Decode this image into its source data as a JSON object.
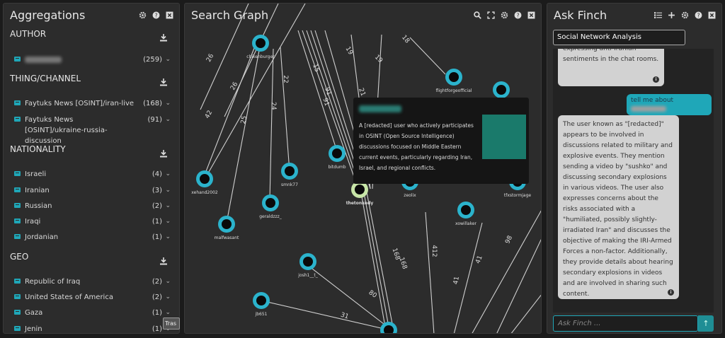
{
  "aggregations": {
    "title": "Aggregations",
    "sections": [
      {
        "name": "AUTHOR",
        "items": [
          {
            "label": "",
            "count": "(259)"
          }
        ]
      },
      {
        "name": "THING/CHANNEL",
        "items": [
          {
            "label": "Faytuks News [OSINT]/iran-live",
            "count": "(168)"
          },
          {
            "label": "Faytuks News [OSINT]/ukraine-russia-discussion",
            "count": "(91)"
          }
        ]
      },
      {
        "name": "NATIONALITY",
        "items": [
          {
            "label": "Israeli",
            "count": "(4)"
          },
          {
            "label": "Iranian",
            "count": "(3)"
          },
          {
            "label": "Russian",
            "count": "(2)"
          },
          {
            "label": "Iraqi",
            "count": "(1)"
          },
          {
            "label": "Jordanian",
            "count": "(1)"
          }
        ]
      },
      {
        "name": "GEO",
        "items": [
          {
            "label": "Republic of Iraq",
            "count": "(2)"
          },
          {
            "label": "United States of America",
            "count": "(2)"
          },
          {
            "label": "Gaza",
            "count": "(1)"
          },
          {
            "label": "Jenin",
            "count": "(1)"
          }
        ]
      }
    ]
  },
  "graph": {
    "title": "Search Graph",
    "node_labels": {
      "n1": "chikenburger",
      "n2": "flightforgeofficial",
      "n3": "xehand2002",
      "n4": "smnk77",
      "n5": "bitdumb",
      "n6": "geraldzzz_",
      "n7": "thetonkedy",
      "n8": "zeolix",
      "n9": "tfxstormjage",
      "n10": "xowillaker",
      "n11": "malfwasant",
      "n12": "josh1__t_",
      "n13": "jb651"
    },
    "edge_labels": [
      "26",
      "26",
      "18",
      "19",
      "19",
      "15",
      "91",
      "21",
      "22",
      "24",
      "42",
      "25",
      "91",
      "168",
      "168",
      "412",
      "41",
      "41",
      "98",
      "80",
      "31"
    ],
    "tooltip": {
      "text": "A [redacted] user who actively participates in OSINT (Open Source Intelligence) discussions focused on Middle Eastern current events, particularly regarding Iran, Israel, and regional conflicts."
    }
  },
  "finch": {
    "title": "Ask Finch",
    "query": "Social Network Analysis",
    "prev_message": "expressing anti-Iranian sentiments in the chat rooms.",
    "user_message": "tell me about",
    "response": "The user known as \"[redacted]\" appears to be involved in discussions related to military and explosive events. They mention sending a video by \"sushko\" and discussing secondary explosions in various videos. The user also expresses concerns about the risks associated with a \"humiliated, possibly slightly-irradiated Iran\" and discusses the objective of making the IRI-Armed Forces a non-factor. Additionally, they provide details about hearing secondary explosions in videos and are involved in sharing such content.",
    "placeholder": "Ask Finch ...",
    "trash_label": "Tras"
  },
  "colors": {
    "accent": "#1fa7b8",
    "node_ring": "#2bb3cc",
    "highlight": "#c8e6a8",
    "tooltip_bg": "#151515",
    "teal_block": "#1a7a6b"
  }
}
